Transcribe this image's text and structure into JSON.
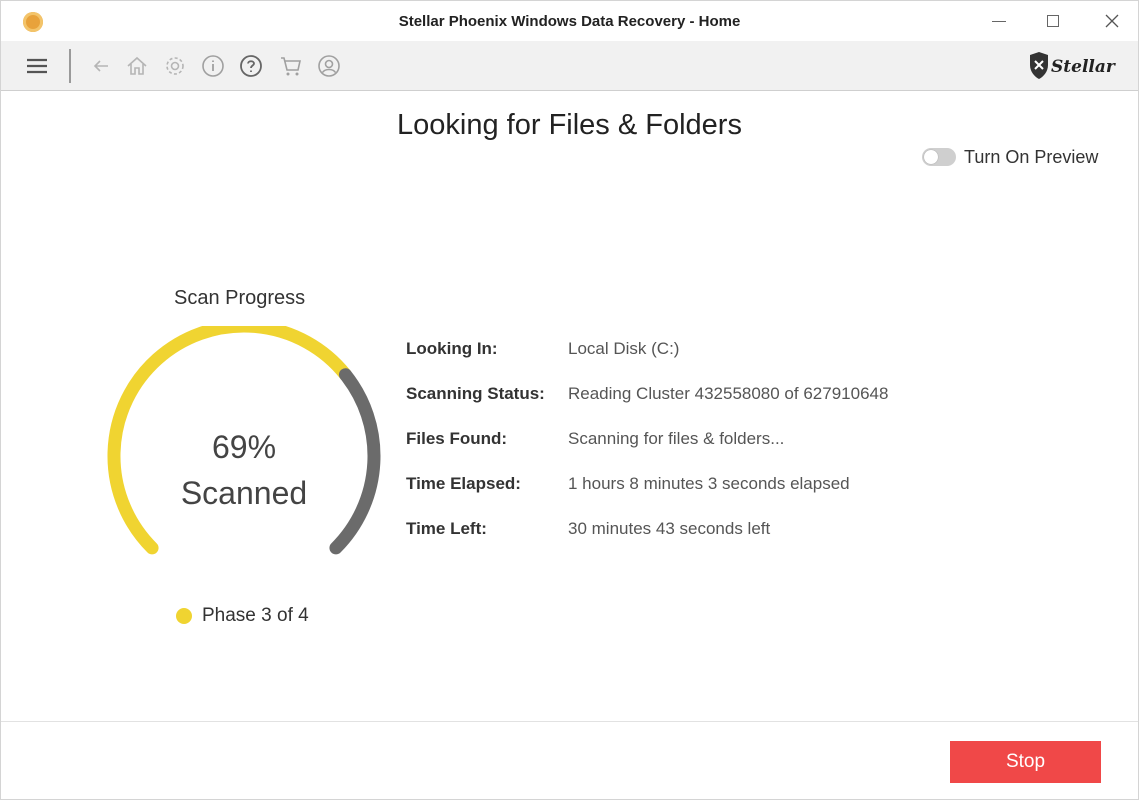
{
  "window": {
    "title": "Stellar Phoenix Windows Data Recovery - Home"
  },
  "toolbar": {
    "logo_text": "Stellar",
    "icons": [
      "menu-icon",
      "back-icon",
      "home-icon",
      "settings-icon",
      "info-icon",
      "help-icon",
      "cart-icon",
      "user-icon"
    ]
  },
  "main": {
    "title": "Looking for Files & Folders",
    "preview_toggle_label": "Turn On Preview",
    "preview_enabled": false
  },
  "scan": {
    "progress_label": "Scan Progress",
    "percent_text": "69%",
    "scanned_text": "Scanned",
    "percent_value": 69,
    "phase_text": "Phase 3 of 4",
    "progress_color": "#f0d431",
    "remaining_color": "#6b6b6b"
  },
  "details": [
    {
      "label": "Looking In:",
      "value": "Local Disk (C:)"
    },
    {
      "label": "Scanning Status:",
      "value": "Reading Cluster 432558080 of 627910648"
    },
    {
      "label": "Files Found:",
      "value": "Scanning for files & folders..."
    },
    {
      "label": "Time Elapsed:",
      "value": "1 hours 8 minutes 3 seconds elapsed"
    },
    {
      "label": "Time Left:",
      "value": "30 minutes 43 seconds left"
    }
  ],
  "footer": {
    "stop_label": "Stop",
    "stop_color": "#f04848"
  }
}
